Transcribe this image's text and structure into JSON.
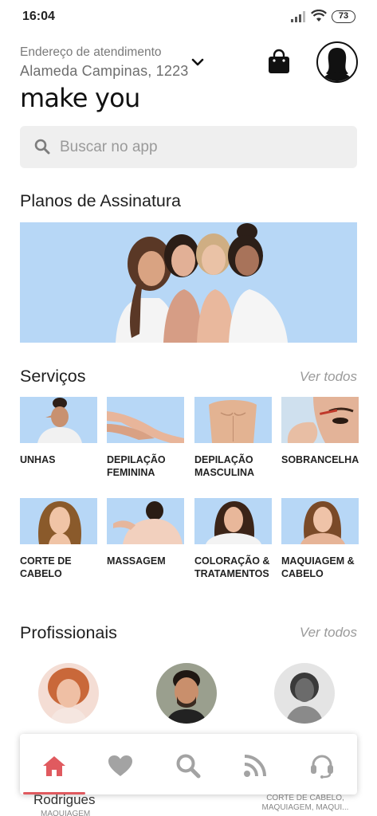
{
  "status_bar": {
    "time": "16:04",
    "battery": "73"
  },
  "header": {
    "address_label": "Endereço de atendimento",
    "address_value": "Alameda Campinas, 1223",
    "logo": "make you"
  },
  "search": {
    "placeholder": "Buscar no app"
  },
  "subscription": {
    "title": "Planos de Assinatura"
  },
  "services": {
    "title": "Serviços",
    "see_all": "Ver todos",
    "items": [
      {
        "label": "UNHAS"
      },
      {
        "label": "DEPILAÇÃO FEMININA"
      },
      {
        "label": "DEPILAÇÃO MASCULINA"
      },
      {
        "label": "SOBRANCELHA"
      },
      {
        "label": "CORTE DE CABELO"
      },
      {
        "label": "MASSAGEM"
      },
      {
        "label": "COLORAÇÃO & TRATAMENTOS"
      },
      {
        "label": "MAQUIAGEM & CABELO"
      }
    ]
  },
  "professionals": {
    "title": "Profissionais",
    "see_all": "Ver todos",
    "items": [
      {
        "name": "Rodrigues",
        "role": "MAQUIAGEM"
      },
      {
        "name": "",
        "role": ""
      },
      {
        "name": "",
        "role": "CORTE DE CABELO, MAQUIAGEM, MAQUI..."
      }
    ]
  },
  "bottom_nav": {
    "items": [
      {
        "icon": "home-icon",
        "active": true
      },
      {
        "icon": "heart-icon",
        "active": false
      },
      {
        "icon": "search-icon",
        "active": false
      },
      {
        "icon": "feed-icon",
        "active": false
      },
      {
        "icon": "support-icon",
        "active": false
      }
    ]
  },
  "colors": {
    "accent": "#e05a5f",
    "banner_bg": "#b7d7f6",
    "icon_gray": "#9a9a9a"
  }
}
